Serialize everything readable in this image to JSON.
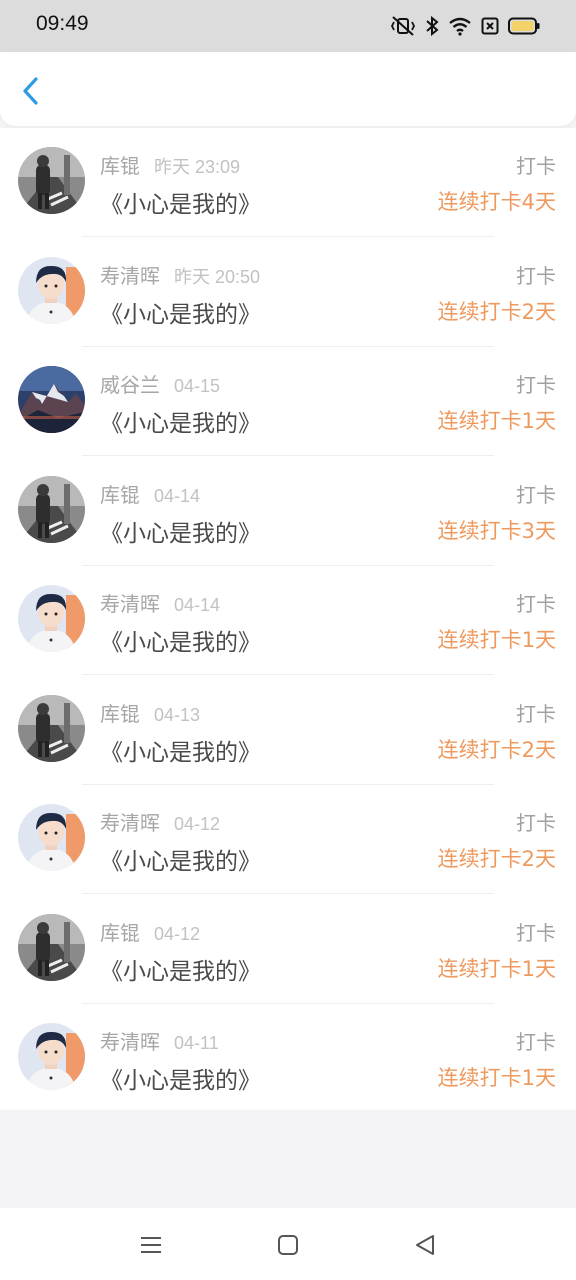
{
  "status_bar": {
    "time": "09:49",
    "icons": [
      "vibrate-icon",
      "bluetooth-icon",
      "wifi-icon",
      "sim-off-icon",
      "battery-icon"
    ]
  },
  "header": {
    "back_icon": "chevron-left-icon",
    "back_color": "#2f9be6"
  },
  "colors": {
    "accent": "#ee9a5e",
    "name_gray": "#a6a6a6",
    "text_dark": "#4a4a4a"
  },
  "records": [
    {
      "name": "库锟",
      "date": "昨天 23:09",
      "book": "《小心是我的》",
      "type": "打卡",
      "streak": "连续打卡4天",
      "avatar": "street-photo"
    },
    {
      "name": "寿清晖",
      "date": "昨天 20:50",
      "book": "《小心是我的》",
      "type": "打卡",
      "streak": "连续打卡2天",
      "avatar": "boy-portrait"
    },
    {
      "name": "威谷兰",
      "date": "04-15",
      "book": "《小心是我的》",
      "type": "打卡",
      "streak": "连续打卡1天",
      "avatar": "mountain-sky"
    },
    {
      "name": "库锟",
      "date": "04-14",
      "book": "《小心是我的》",
      "type": "打卡",
      "streak": "连续打卡3天",
      "avatar": "street-photo"
    },
    {
      "name": "寿清晖",
      "date": "04-14",
      "book": "《小心是我的》",
      "type": "打卡",
      "streak": "连续打卡1天",
      "avatar": "boy-portrait"
    },
    {
      "name": "库锟",
      "date": "04-13",
      "book": "《小心是我的》",
      "type": "打卡",
      "streak": "连续打卡2天",
      "avatar": "street-photo"
    },
    {
      "name": "寿清晖",
      "date": "04-12",
      "book": "《小心是我的》",
      "type": "打卡",
      "streak": "连续打卡2天",
      "avatar": "boy-portrait"
    },
    {
      "name": "库锟",
      "date": "04-12",
      "book": "《小心是我的》",
      "type": "打卡",
      "streak": "连续打卡1天",
      "avatar": "street-photo"
    },
    {
      "name": "寿清晖",
      "date": "04-11",
      "book": "《小心是我的》",
      "type": "打卡",
      "streak": "连续打卡1天",
      "avatar": "boy-portrait"
    }
  ],
  "nav_bar": {
    "icons": [
      "menu-icon",
      "home-square-icon",
      "back-triangle-icon"
    ]
  }
}
